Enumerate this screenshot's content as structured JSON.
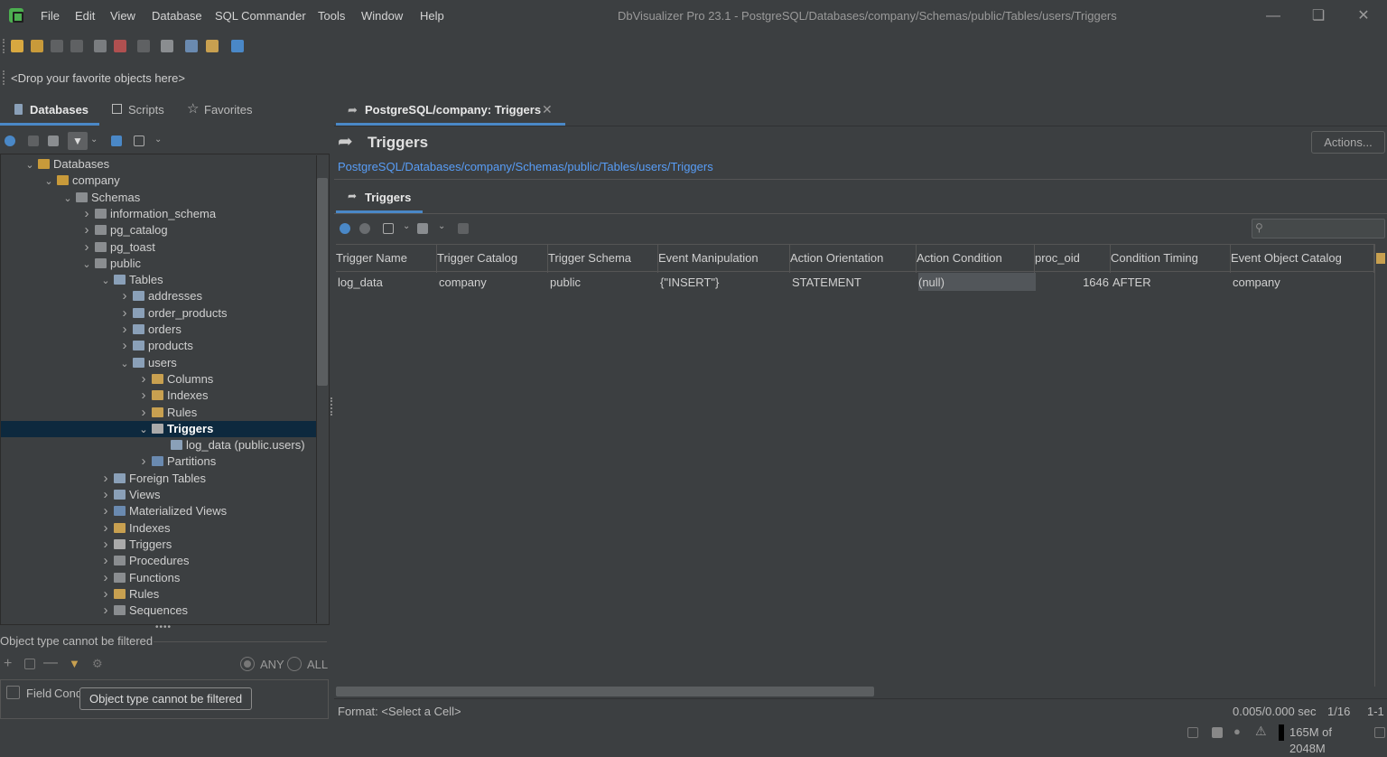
{
  "app": {
    "window_title": "DbVisualizer Pro 23.1 - PostgreSQL/Databases/company/Schemas/public/Tables/users/Triggers",
    "menu": [
      "File",
      "Edit",
      "View",
      "Database",
      "SQL Commander",
      "Tools",
      "Window",
      "Help"
    ]
  },
  "favorites": {
    "placeholder": "<Drop your favorite objects here>"
  },
  "left_tabs": {
    "databases": "Databases",
    "scripts": "Scripts",
    "favorites": "Favorites"
  },
  "tree": [
    {
      "label": "Databases",
      "depth": 0,
      "chev": "open"
    },
    {
      "label": "company",
      "depth": 1,
      "chev": "open"
    },
    {
      "label": "Schemas",
      "depth": 2,
      "chev": "open"
    },
    {
      "label": "information_schema",
      "depth": 3,
      "chev": "closed"
    },
    {
      "label": "pg_catalog",
      "depth": 3,
      "chev": "closed"
    },
    {
      "label": "pg_toast",
      "depth": 3,
      "chev": "closed"
    },
    {
      "label": "public",
      "depth": 3,
      "chev": "open"
    },
    {
      "label": "Tables",
      "depth": 4,
      "chev": "open"
    },
    {
      "label": "addresses",
      "depth": 5,
      "chev": "closed"
    },
    {
      "label": "order_products",
      "depth": 5,
      "chev": "closed"
    },
    {
      "label": "orders",
      "depth": 5,
      "chev": "closed"
    },
    {
      "label": "products",
      "depth": 5,
      "chev": "closed"
    },
    {
      "label": "users",
      "depth": 5,
      "chev": "open"
    },
    {
      "label": "Columns",
      "depth": 6,
      "chev": "closed"
    },
    {
      "label": "Indexes",
      "depth": 6,
      "chev": "closed"
    },
    {
      "label": "Rules",
      "depth": 6,
      "chev": "closed"
    },
    {
      "label": "Triggers",
      "depth": 6,
      "chev": "open",
      "selected": true
    },
    {
      "label": "log_data (public.users)",
      "depth": 7,
      "chev": "none"
    },
    {
      "label": "Partitions",
      "depth": 6,
      "chev": "closed"
    },
    {
      "label": "Foreign Tables",
      "depth": 4,
      "chev": "closed"
    },
    {
      "label": "Views",
      "depth": 4,
      "chev": "closed"
    },
    {
      "label": "Materialized Views",
      "depth": 4,
      "chev": "closed"
    },
    {
      "label": "Indexes",
      "depth": 4,
      "chev": "closed"
    },
    {
      "label": "Triggers",
      "depth": 4,
      "chev": "closed"
    },
    {
      "label": "Procedures",
      "depth": 4,
      "chev": "closed"
    },
    {
      "label": "Functions",
      "depth": 4,
      "chev": "closed"
    },
    {
      "label": "Rules",
      "depth": 4,
      "chev": "closed"
    },
    {
      "label": "Sequences",
      "depth": 4,
      "chev": "closed"
    }
  ],
  "filter": {
    "label": "Object type cannot be filtered",
    "any": "ANY",
    "all": "ALL",
    "field_header": "Field",
    "cond_header": "Cond",
    "tooltip": "Object type cannot be filtered"
  },
  "editor": {
    "tab_label": "PostgreSQL/company: Triggers",
    "title": "Triggers",
    "actions": "Actions...",
    "breadcrumb": "PostgreSQL/Databases/company/Schemas/public/Tables/users/Triggers",
    "subtab": "Triggers"
  },
  "grid": {
    "columns": [
      "Trigger Name",
      "Trigger Catalog",
      "Trigger Schema",
      "Event Manipulation",
      "Action Orientation",
      "Action Condition",
      "proc_oid",
      "Condition Timing",
      "Event Object Catalog"
    ],
    "rows": [
      [
        "log_data",
        "company",
        "public",
        "{\"INSERT\"}",
        "STATEMENT",
        "(null)",
        "1646",
        "AFTER",
        "company"
      ]
    ]
  },
  "status": {
    "format": "Format: <Select a Cell>",
    "timing": "0.005/0.000 sec",
    "rowcount": "1/16",
    "rowrange": "1-1",
    "memory": "165M of 2048M"
  }
}
